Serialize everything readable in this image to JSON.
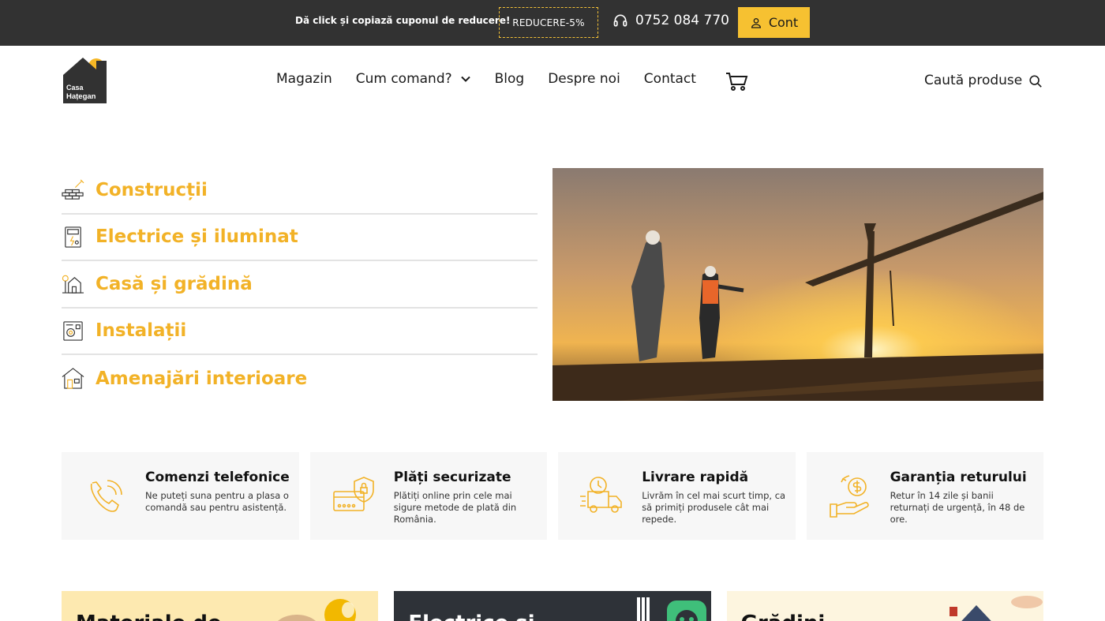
{
  "topbar": {
    "promo_text": "Dă click și copiază cuponul de reducere!",
    "coupon_code": "REDUCERE-5%",
    "phone": "0752 084 770",
    "account_label": "Cont"
  },
  "header": {
    "logo_text_line1": "Casa",
    "logo_text_line2": "Hațegan",
    "nav": [
      {
        "label": "Magazin"
      },
      {
        "label": "Cum comand?"
      },
      {
        "label": "Blog"
      },
      {
        "label": "Despre noi"
      },
      {
        "label": "Contact"
      }
    ],
    "search_label": "Caută produse"
  },
  "categories": [
    {
      "label": "Construcții",
      "icon": "bricks-trowel-icon"
    },
    {
      "label": "Electrice și iluminat",
      "icon": "electrical-panel-icon"
    },
    {
      "label": "Casă și grădină",
      "icon": "house-garden-icon"
    },
    {
      "label": "Instalații",
      "icon": "boiler-icon"
    },
    {
      "label": "Amenajări interioare",
      "icon": "house-interior-icon"
    }
  ],
  "features": [
    {
      "title": "Comenzi telefonice",
      "text": "Ne puteți suna pentru a plasa o comandă sau pentru asistență.",
      "icon": "phone-call-icon"
    },
    {
      "title": "Plăți securizate",
      "text": "Plătiți online prin cele mai sigure metode de plată din România.",
      "icon": "secure-card-icon"
    },
    {
      "title": "Livrare rapidă",
      "text": "Livrăm în cel mai scurt timp, ca să primiți produsele cât mai repede.",
      "icon": "fast-delivery-truck-icon"
    },
    {
      "title": "Garanția returului",
      "text": "Retur în 14 zile și banii returnați de urgență, în 48 de ore.",
      "icon": "money-return-icon"
    }
  ],
  "cards": [
    {
      "title": "Materiale de"
    },
    {
      "title": "Electrice și"
    },
    {
      "title": "Grădini"
    }
  ],
  "colors": {
    "accent": "#f2b227",
    "topbar_bg": "#323232",
    "account_bg": "#f6c131"
  }
}
